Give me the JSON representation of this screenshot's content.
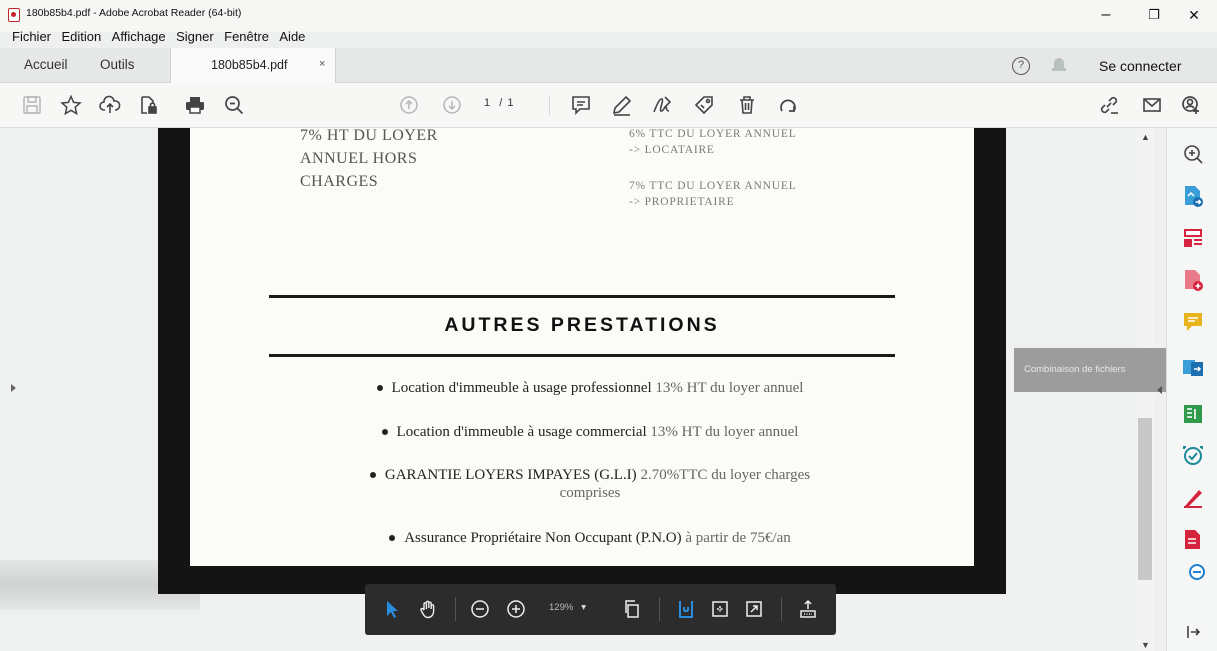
{
  "window": {
    "title": "180b85b4.pdf - Adobe Acrobat Reader (64-bit)",
    "minimize_glyph": "–",
    "maximize_glyph": "❐",
    "close_glyph": "✕"
  },
  "menubar": {
    "items": [
      "Fichier",
      "Edition",
      "Affichage",
      "Signer",
      "Fenêtre",
      "Aide"
    ]
  },
  "tabs": {
    "home": "Accueil",
    "tools": "Outils",
    "document": "180b85b4.pdf",
    "close_glyph": "×",
    "help_glyph": "?",
    "signin": "Se connecter"
  },
  "toolbar": {
    "page_current": "1",
    "page_total": "/ 1",
    "icons": [
      "save-icon",
      "star-icon",
      "upload-icon",
      "file-lock-icon",
      "print-icon",
      "zoom-search-icon",
      "page-up-icon",
      "page-down-icon",
      "comment-icon",
      "pen-icon",
      "sign-icon",
      "tag-icon",
      "trash-icon",
      "rotate-icon",
      "share-link-icon",
      "email-icon",
      "account-icon"
    ]
  },
  "document": {
    "rent_left": [
      "7% HT DU LOYER",
      "ANNUEL HORS",
      "CHARGES"
    ],
    "rent_right_1": [
      "6% TTC DU LOYER ANNUEL",
      "-> LOCATAIRE"
    ],
    "rent_right_2": [
      "7% TTC DU LOYER ANNUEL",
      "-> PROPRIETAIRE"
    ],
    "section_title": "AUTRES PRESTATIONS",
    "bullets": [
      {
        "main": "Location  d'immeuble à usage professionnel",
        "detail": " 13% HT du loyer annuel"
      },
      {
        "main": "Location d'immeuble à usage commercial",
        "detail": " 13% HT du loyer annuel"
      },
      {
        "main": "GARANTIE LOYERS IMPAYES (G.L.I)",
        "detail": " 2.70%TTC du loyer charges",
        "detail2": "comprises"
      },
      {
        "main": "Assurance Propriétaire Non Occupant (P.N.O)",
        "detail": " à partir de 75€/an"
      }
    ]
  },
  "bottom_bar": {
    "zoom": "129%",
    "zoom_caret": "▾"
  },
  "right_panel": {
    "tooltip": "Combinaison de fichiers"
  },
  "colors": {
    "accent_blue": "#1f7fd0",
    "accent_red": "#d5243d",
    "accent_green": "#2f9a4a",
    "accent_yellow": "#e8b51f"
  }
}
